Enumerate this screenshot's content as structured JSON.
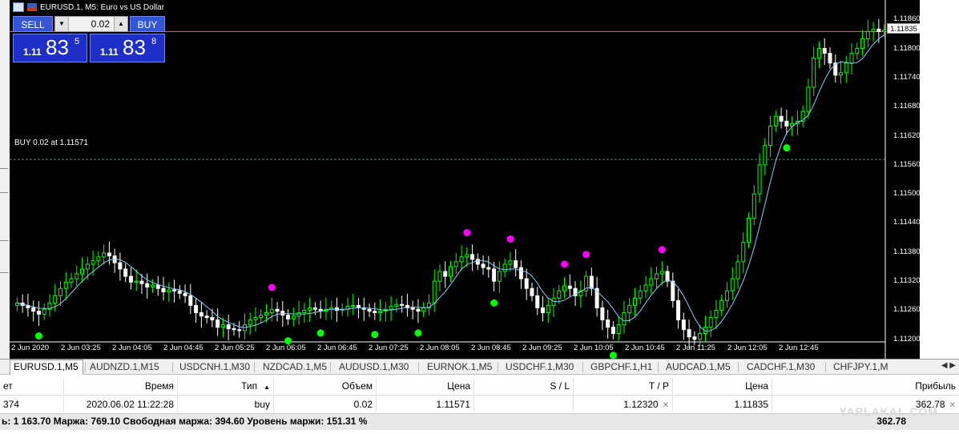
{
  "window": {
    "title": "EURUSD.1, M5:  Euro vs US Dollar"
  },
  "trade_panel": {
    "sell_label": "SELL",
    "buy_label": "BUY",
    "lot": "0.02",
    "sell_price": {
      "small": "1.11",
      "big": "83",
      "sup": "5"
    },
    "buy_price": {
      "small": "1.11",
      "big": "83",
      "sup": "8"
    }
  },
  "order_line_label": "BUY 0.02 at 1.11571",
  "current_price": "1.11835",
  "colors": {
    "background": "#000000",
    "bull_candle": "#00ff00",
    "bear_candle": "#ffffff",
    "ma_line": "#87cefa",
    "signal_up": "#00ff00",
    "signal_down": "#ff00ff",
    "bid_line": "#ff6070",
    "order_line": "#5a8a5a"
  },
  "chart_data": {
    "type": "candlestick",
    "symbol": "EURUSD.1",
    "timeframe": "M5",
    "y_ticks": [
      "1.11860",
      "1.11800",
      "1.11740",
      "1.11680",
      "1.11620",
      "1.11560",
      "1.11500",
      "1.11440",
      "1.11380",
      "1.11320",
      "1.11260",
      "1.11200"
    ],
    "ylim": [
      1.1116,
      1.119
    ],
    "x_ticks": [
      "2 Jun 2020",
      "2 Jun 03:25",
      "2 Jun 04:05",
      "2 Jun 04:45",
      "2 Jun 05:25",
      "2 Jun 06:05",
      "2 Jun 06:45",
      "2 Jun 07:25",
      "2 Jun 08:05",
      "2 Jun 08:45",
      "2 Jun 09:25",
      "2 Jun 10:05",
      "2 Jun 10:45",
      "2 Jun 11:25",
      "2 Jun 12:05",
      "2 Jun 12:45"
    ],
    "close": [
      1.11275,
      1.1127,
      1.11265,
      1.11258,
      1.11252,
      1.11262,
      1.11275,
      1.1129,
      1.11305,
      1.11318,
      1.11325,
      1.11335,
      1.11345,
      1.11355,
      1.11362,
      1.1137,
      1.11378,
      1.11372,
      1.11358,
      1.11345,
      1.1133,
      1.11318,
      1.1132,
      1.11315,
      1.11308,
      1.11312,
      1.11305,
      1.11298,
      1.11302,
      1.113,
      1.11295,
      1.1129,
      1.1127,
      1.11255,
      1.11248,
      1.11245,
      1.1124,
      1.11225,
      1.1123,
      1.11222,
      1.1122,
      1.11218,
      1.1123,
      1.1124,
      1.11245,
      1.1125,
      1.11255,
      1.11262,
      1.11258,
      1.1125,
      1.11242,
      1.11248,
      1.11255,
      1.1126,
      1.11265,
      1.11262,
      1.11258,
      1.11262,
      1.11265,
      1.1126,
      1.11262,
      1.11268,
      1.1127,
      1.11265,
      1.11262,
      1.11258,
      1.11255,
      1.11258,
      1.11262,
      1.11268,
      1.11272,
      1.1127,
      1.11265,
      1.11262,
      1.11258,
      1.11265,
      1.11275,
      1.1132,
      1.1134,
      1.1133,
      1.1135,
      1.1136,
      1.1137,
      1.11375,
      1.11365,
      1.11355,
      1.11348,
      1.11345,
      1.1132,
      1.1134,
      1.11355,
      1.11362,
      1.11348,
      1.11325,
      1.11305,
      1.1129,
      1.11265,
      1.11255,
      1.1127,
      1.11285,
      1.113,
      1.1131,
      1.11305,
      1.1129,
      1.113,
      1.1133,
      1.11305,
      1.11265,
      1.1124,
      1.11225,
      1.11212,
      1.1123,
      1.11255,
      1.1127,
      1.11285,
      1.113,
      1.11312,
      1.11325,
      1.11335,
      1.1134,
      1.1132,
      1.1128,
      1.1124,
      1.1122,
      1.11205,
      1.112,
      1.11212,
      1.11225,
      1.11245,
      1.1126,
      1.1128,
      1.113,
      1.11325,
      1.1136,
      1.114,
      1.1145,
      1.115,
      1.1156,
      1.116,
      1.1164,
      1.1166,
      1.1165,
      1.1164,
      1.11645,
      1.1165,
      1.1167,
      1.1172,
      1.1178,
      1.118,
      1.1179,
      1.1177,
      1.11745,
      1.1175,
      1.1177,
      1.1179,
      1.118,
      1.1182,
      1.11835,
      1.1184,
      1.11835,
      1.11838
    ]
  },
  "tabs": [
    {
      "label": "EURUSD.1,M5",
      "active": true
    },
    {
      "label": "AUDNZD.1,M15"
    },
    {
      "label": "USDCNH.1,M30"
    },
    {
      "label": "NZDCAD.1,M5"
    },
    {
      "label": "AUDUSD.1,M30"
    },
    {
      "label": "EURNOK.1,M5"
    },
    {
      "label": "USDCHF.1,M30"
    },
    {
      "label": "GBPCHF.1,H1"
    },
    {
      "label": "AUDCAD.1,M5"
    },
    {
      "label": "CADCHF.1,M30"
    },
    {
      "label": "CHFJPY.1,M"
    }
  ],
  "tab_arrows": "◀ ▶",
  "table": {
    "headers": {
      "ticket": "ет",
      "time": "Время",
      "type": "Тип",
      "volume": "Объем",
      "price": "Цена",
      "sl": "S / L",
      "tp": "T / P",
      "current": "Цена",
      "profit": "Прибыль"
    },
    "row": {
      "ticket": "374",
      "time": "2020.06.02 11:22:28",
      "type": "buy",
      "volume": "0.02",
      "price": "1.11571",
      "sl": "",
      "tp": "1.12320",
      "current": "1.11835",
      "profit": "362.78"
    }
  },
  "footer": {
    "summary": "ь: 1 163.70  Маржа: 769.10  Свободная маржа: 394.60  Уровень маржи: 151.31 %",
    "total": "362.78"
  },
  "watermark": "YAPLAKAL.COM"
}
